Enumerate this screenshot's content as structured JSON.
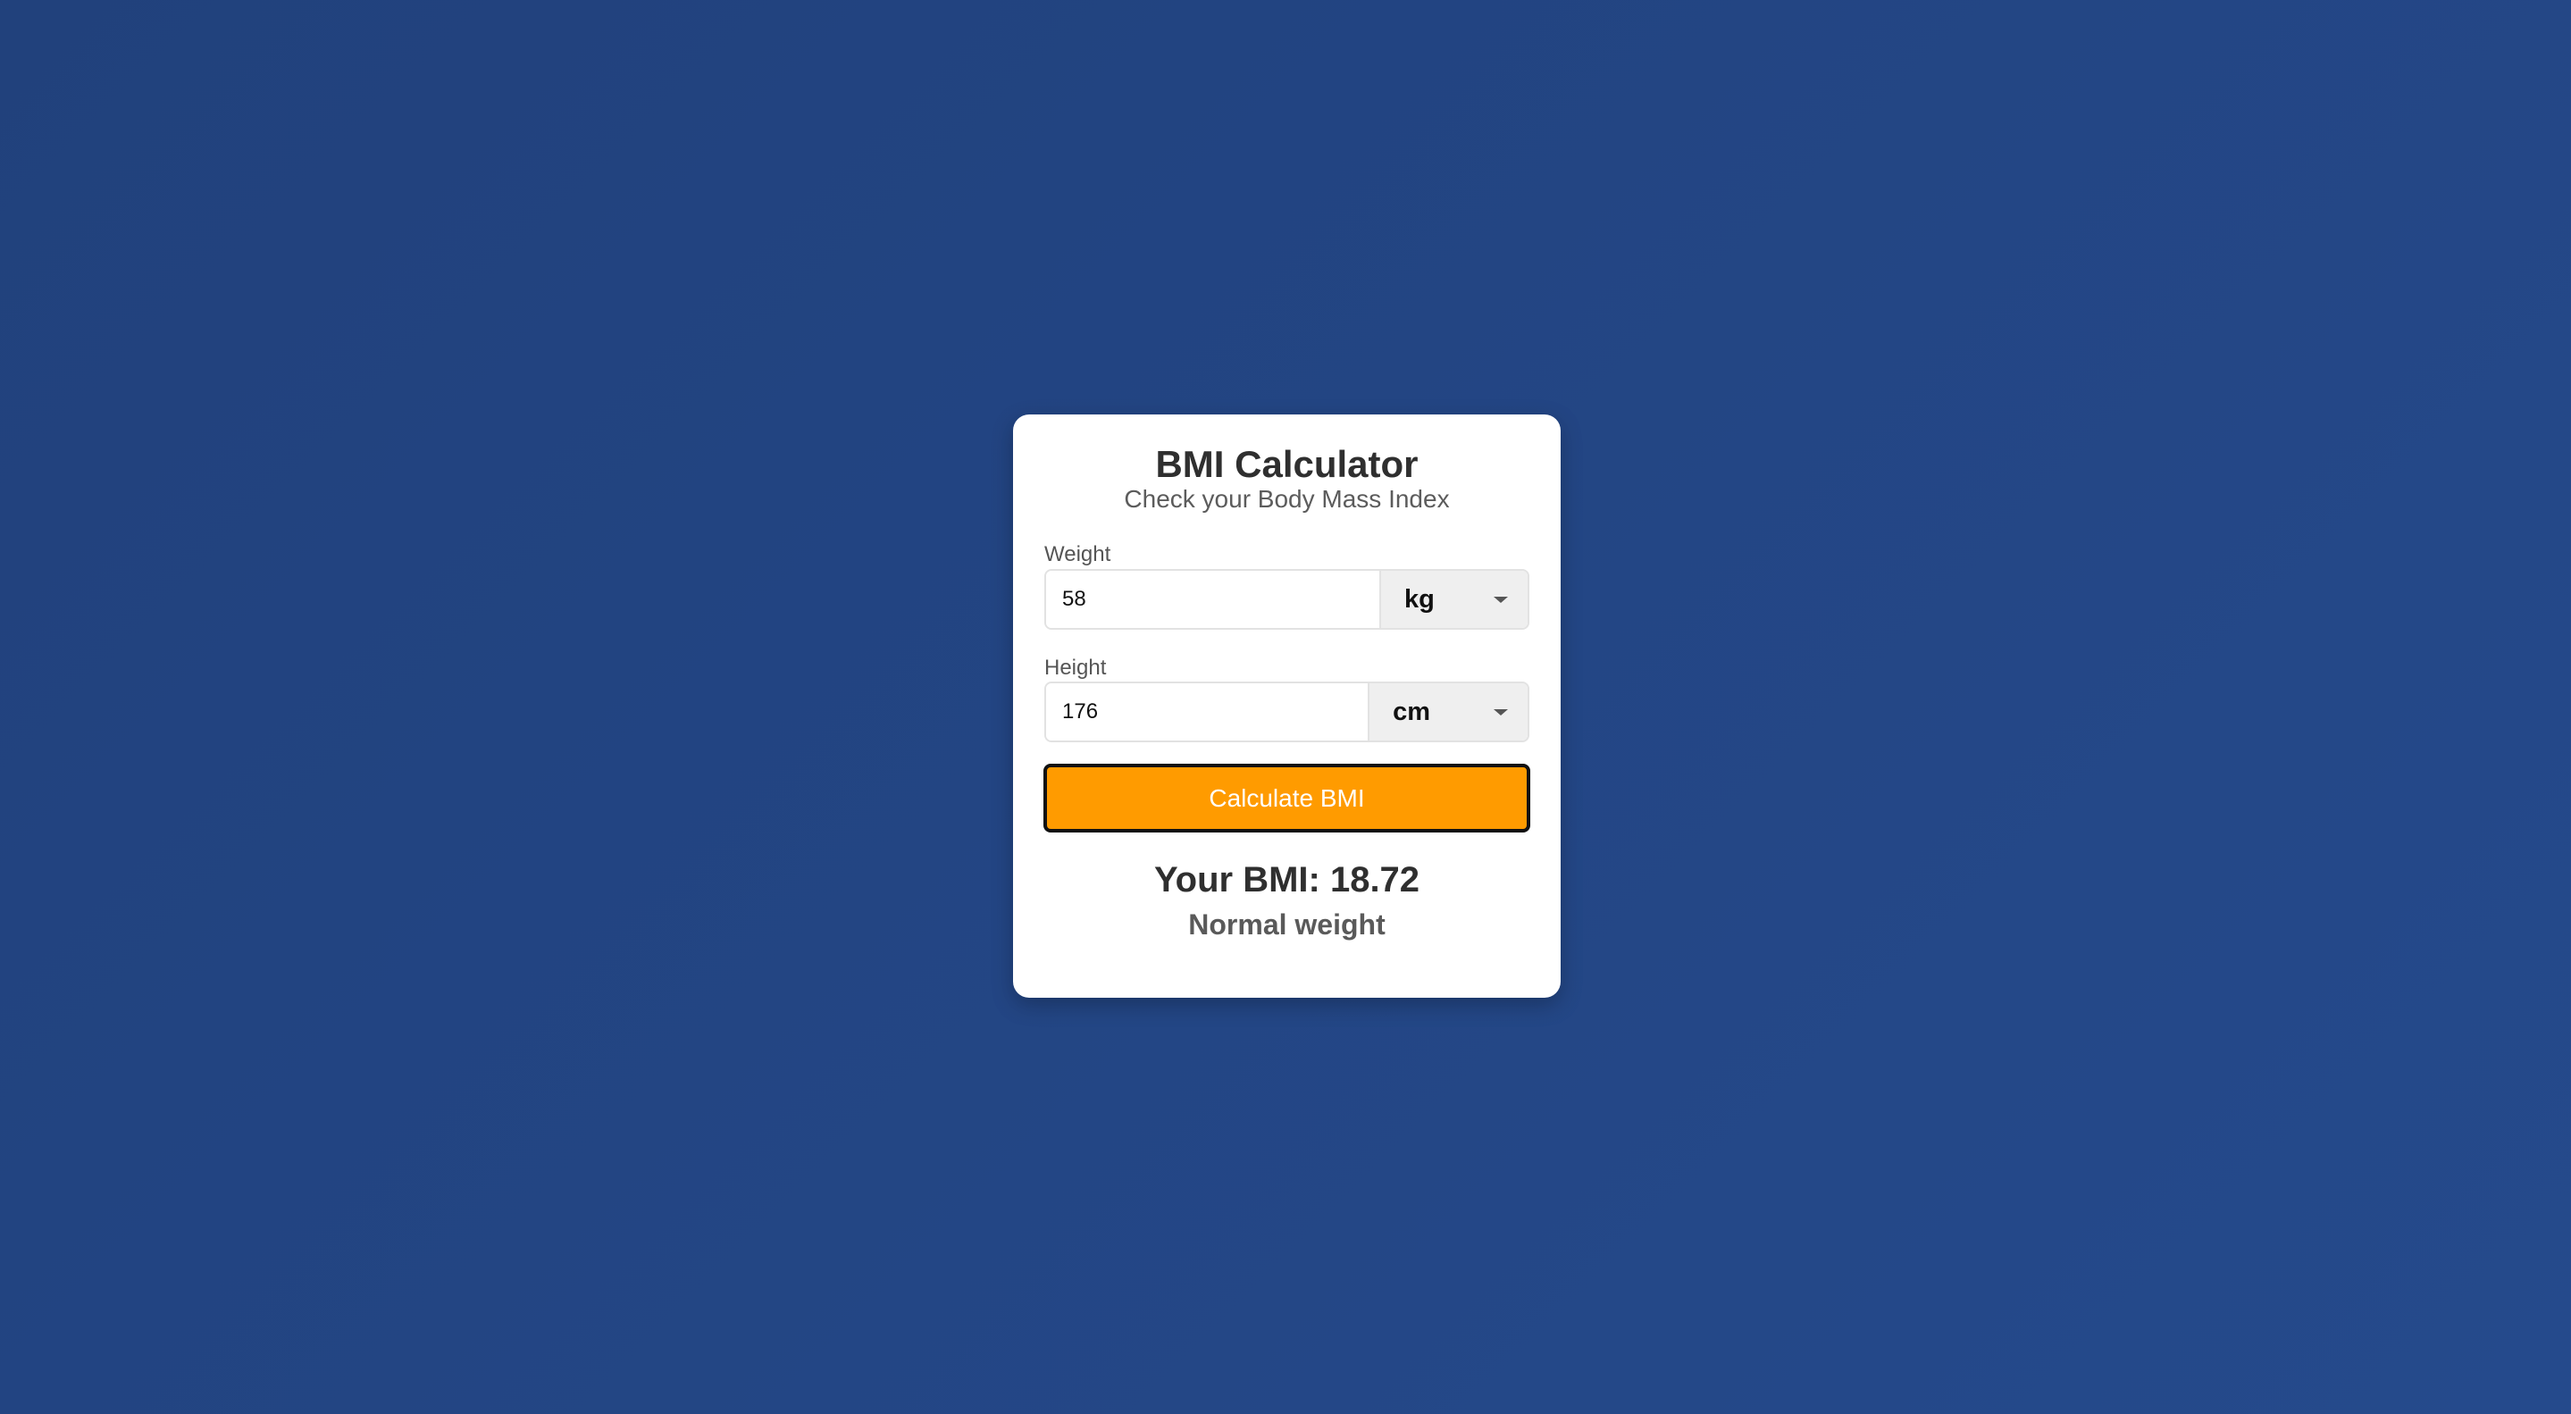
{
  "card": {
    "title": "BMI Calculator",
    "subtitle": "Check your Body Mass Index"
  },
  "weight": {
    "label": "Weight",
    "value": "58",
    "unit": "kg"
  },
  "height": {
    "label": "Height",
    "value": "176",
    "unit": "cm"
  },
  "calculate_button": {
    "label": "Calculate BMI"
  },
  "result": {
    "bmi_text": "Your BMI: 18.72",
    "category": "Normal weight"
  },
  "colors": {
    "background": "#21417c",
    "card": "#ffffff",
    "button": "#ff9b00",
    "button_text": "#ffffff"
  },
  "icons": {
    "unit_dropdown": "chevron-down-icon"
  }
}
